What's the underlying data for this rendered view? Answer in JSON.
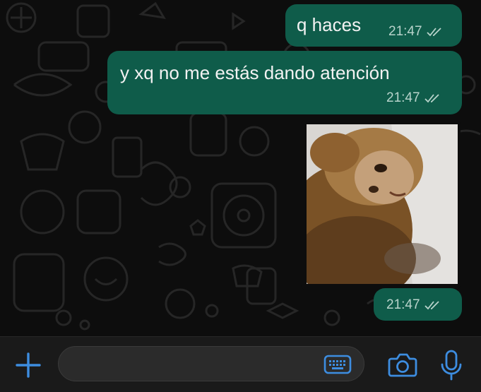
{
  "messages": [
    {
      "text": "q haces",
      "time": "21:47",
      "status": "read"
    },
    {
      "text": "y xq no me estás dando atención",
      "time": "21:47",
      "status": "read"
    },
    {
      "type": "image",
      "image_alt": "capuchin monkey lying on bedsheet",
      "time": "21:47",
      "status": "read"
    }
  ],
  "composer": {
    "placeholder": ""
  },
  "colors": {
    "bubble_out": "#0f5c4a",
    "accent": "#3d8de0",
    "background": "#0d0d0d"
  },
  "icons": [
    "plus-icon",
    "keyboard-icon",
    "camera-icon",
    "microphone-icon",
    "double-check-icon"
  ]
}
